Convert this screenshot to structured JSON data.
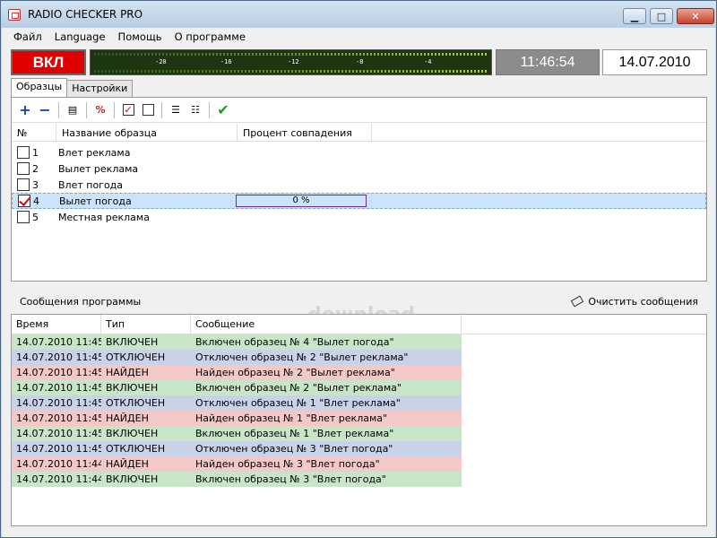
{
  "app": {
    "title": "RADIO CHECKER PRO",
    "window_controls": [
      "minimize-icon",
      "maximize-icon",
      "close-icon"
    ]
  },
  "menu": [
    "Файл",
    "Language",
    "Помощь",
    "О программе"
  ],
  "status": {
    "power": "ВКЛ",
    "time": "11:46:54",
    "date": "14.07.2010",
    "meter_labels": [
      "-20",
      "-16",
      "-12",
      "-8",
      "-4"
    ]
  },
  "tabs": [
    "Образцы",
    "Настройки"
  ],
  "toolbar": [
    "plus-icon",
    "minus-icon",
    "properties-icon",
    "percent-icon",
    "check-all-icon",
    "uncheck-all-icon",
    "list-icon",
    "list-alt-icon",
    "apply-icon"
  ],
  "samples": {
    "headers": [
      "№",
      "Название образца",
      "Процент совпадения"
    ],
    "rows": [
      {
        "num": "1",
        "name": "Влет реклама",
        "checked": false
      },
      {
        "num": "2",
        "name": "Вылет реклама",
        "checked": false
      },
      {
        "num": "3",
        "name": "Влет погода",
        "checked": false
      },
      {
        "num": "4",
        "name": "Вылет погода",
        "checked": true,
        "percent": "0 %"
      },
      {
        "num": "5",
        "name": "Местная реклама",
        "checked": false
      }
    ]
  },
  "watermark": "download",
  "messages": {
    "title": "Сообщения программы",
    "clear_button": "Очистить сообщения",
    "headers": [
      "Время",
      "Тип",
      "Сообщение"
    ],
    "rows": [
      {
        "time": "14.07.2010 11:45:",
        "type": "ВКЛЮЧЕН",
        "message": "Включен образец № 4 \"Вылет погода\"",
        "kind": "on"
      },
      {
        "time": "14.07.2010 11:45:",
        "type": "ОТКЛЮЧЕН",
        "message": "Отключен образец № 2 \"Вылет реклама\"",
        "kind": "off"
      },
      {
        "time": "14.07.2010 11:45:",
        "type": "НАЙДЕН",
        "message": "Найден образец № 2 \"Вылет реклама\"",
        "kind": "found"
      },
      {
        "time": "14.07.2010 11:45:",
        "type": "ВКЛЮЧЕН",
        "message": "Включен образец № 2 \"Вылет реклама\"",
        "kind": "on"
      },
      {
        "time": "14.07.2010 11:45:",
        "type": "ОТКЛЮЧЕН",
        "message": "Отключен образец № 1 \"Влет реклама\"",
        "kind": "off"
      },
      {
        "time": "14.07.2010 11:45:",
        "type": "НАЙДЕН",
        "message": "Найден образец № 1 \"Влет реклама\"",
        "kind": "found"
      },
      {
        "time": "14.07.2010 11:45:",
        "type": "ВКЛЮЧЕН",
        "message": "Включен образец № 1 \"Влет реклама\"",
        "kind": "on"
      },
      {
        "time": "14.07.2010 11:45:",
        "type": "ОТКЛЮЧЕН",
        "message": "Отключен образец № 3 \"Влет погода\"",
        "kind": "off"
      },
      {
        "time": "14.07.2010 11:44:",
        "type": "НАЙДЕН",
        "message": "Найден образец № 3 \"Влет погода\"",
        "kind": "found"
      },
      {
        "time": "14.07.2010 11:44:",
        "type": "ВКЛЮЧЕН",
        "message": "Включен образец № 3 \"Влет погода\"",
        "kind": "on"
      }
    ]
  }
}
